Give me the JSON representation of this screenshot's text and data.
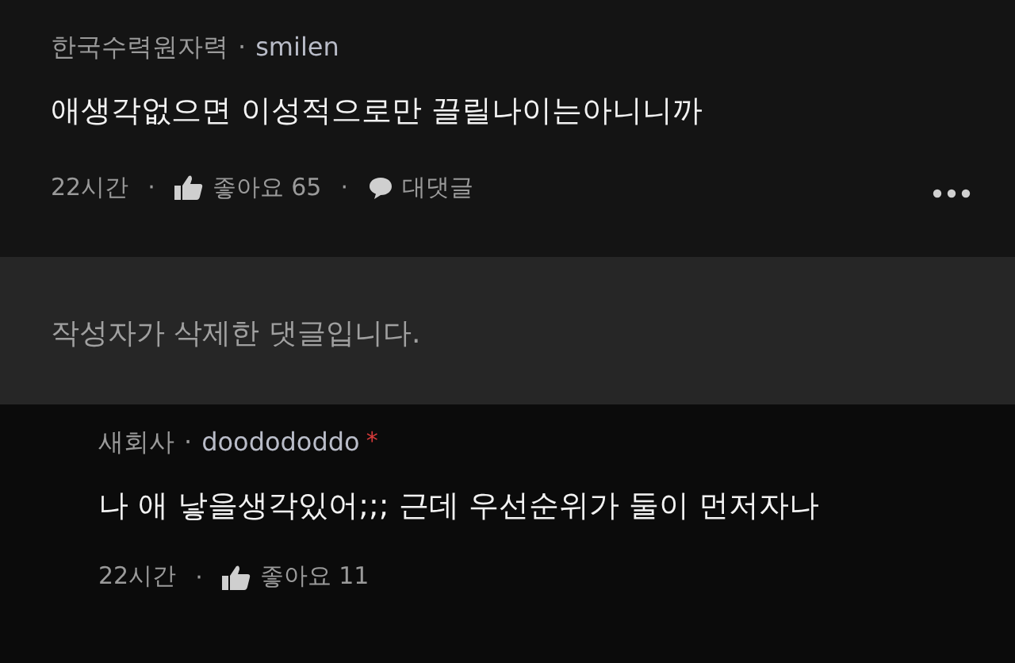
{
  "comments": [
    {
      "kind": "comment",
      "company": "한국수력원자력",
      "separator": "·",
      "username": "smilen",
      "text": "애생각없으면 이성적으로만 끌릴나이는아니니까",
      "footer": [
        {
          "kind": "time",
          "text": "22시간"
        },
        {
          "kind": "dot",
          "text": "·"
        },
        {
          "kind": "like",
          "text": "좋아요 65"
        },
        {
          "kind": "dot",
          "text": "·"
        },
        {
          "kind": "reply",
          "text": "대댓글"
        }
      ],
      "more": true
    },
    {
      "kind": "deleted",
      "text": "작성자가 삭제한 댓글입니다.",
      "children": [
        {
          "kind": "comment",
          "company": "새회사",
          "separator": "·",
          "username": "doodododdo",
          "badge": "*",
          "text": "나 애 낳을생각있어;;; 근데 우선순위가 둘이 먼저자나",
          "footer": [
            {
              "kind": "time",
              "text": "22시간"
            },
            {
              "kind": "dot",
              "text": "·"
            },
            {
              "kind": "like",
              "text": "좋아요 11"
            }
          ],
          "more": false
        }
      ]
    }
  ]
}
